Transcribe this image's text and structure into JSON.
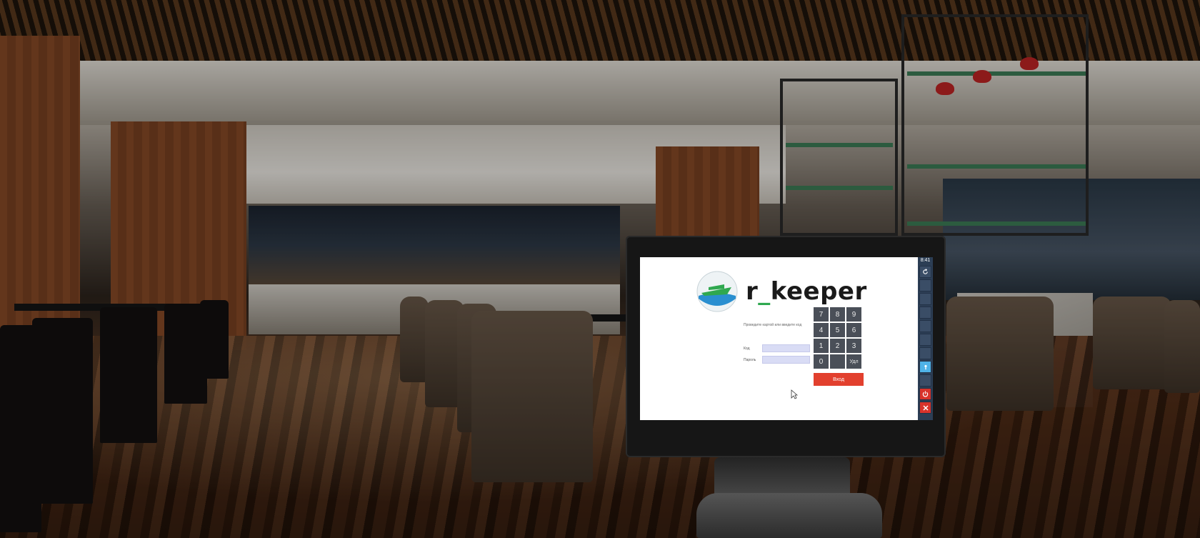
{
  "app": {
    "logo_text_prefix": "r",
    "logo_text_underscore": "_",
    "logo_text_suffix": "keeper",
    "logo_icon": "ship-logo-icon"
  },
  "login": {
    "hint": "Проведите картой или введите код",
    "fields": [
      {
        "label": "Код",
        "value": "",
        "placeholder": ""
      },
      {
        "label": "Пароль",
        "value": "",
        "placeholder": ""
      }
    ],
    "keypad": [
      "7",
      "8",
      "9",
      "4",
      "5",
      "6",
      "1",
      "2",
      "3",
      "0",
      "",
      "Удл"
    ],
    "enter_label": "Вход"
  },
  "sidebar": {
    "time": "8:41",
    "refresh_icon": "refresh-icon",
    "info_icon": "info-icon",
    "power_icon": "power-icon",
    "close_icon": "close-icon"
  },
  "colors": {
    "accent_green": "#2fa84f",
    "keypad_gray": "#4a4f58",
    "enter_red": "#e2402e",
    "sidebar_blue": "#2c3e55",
    "input_lavender": "#d9dcf5"
  }
}
